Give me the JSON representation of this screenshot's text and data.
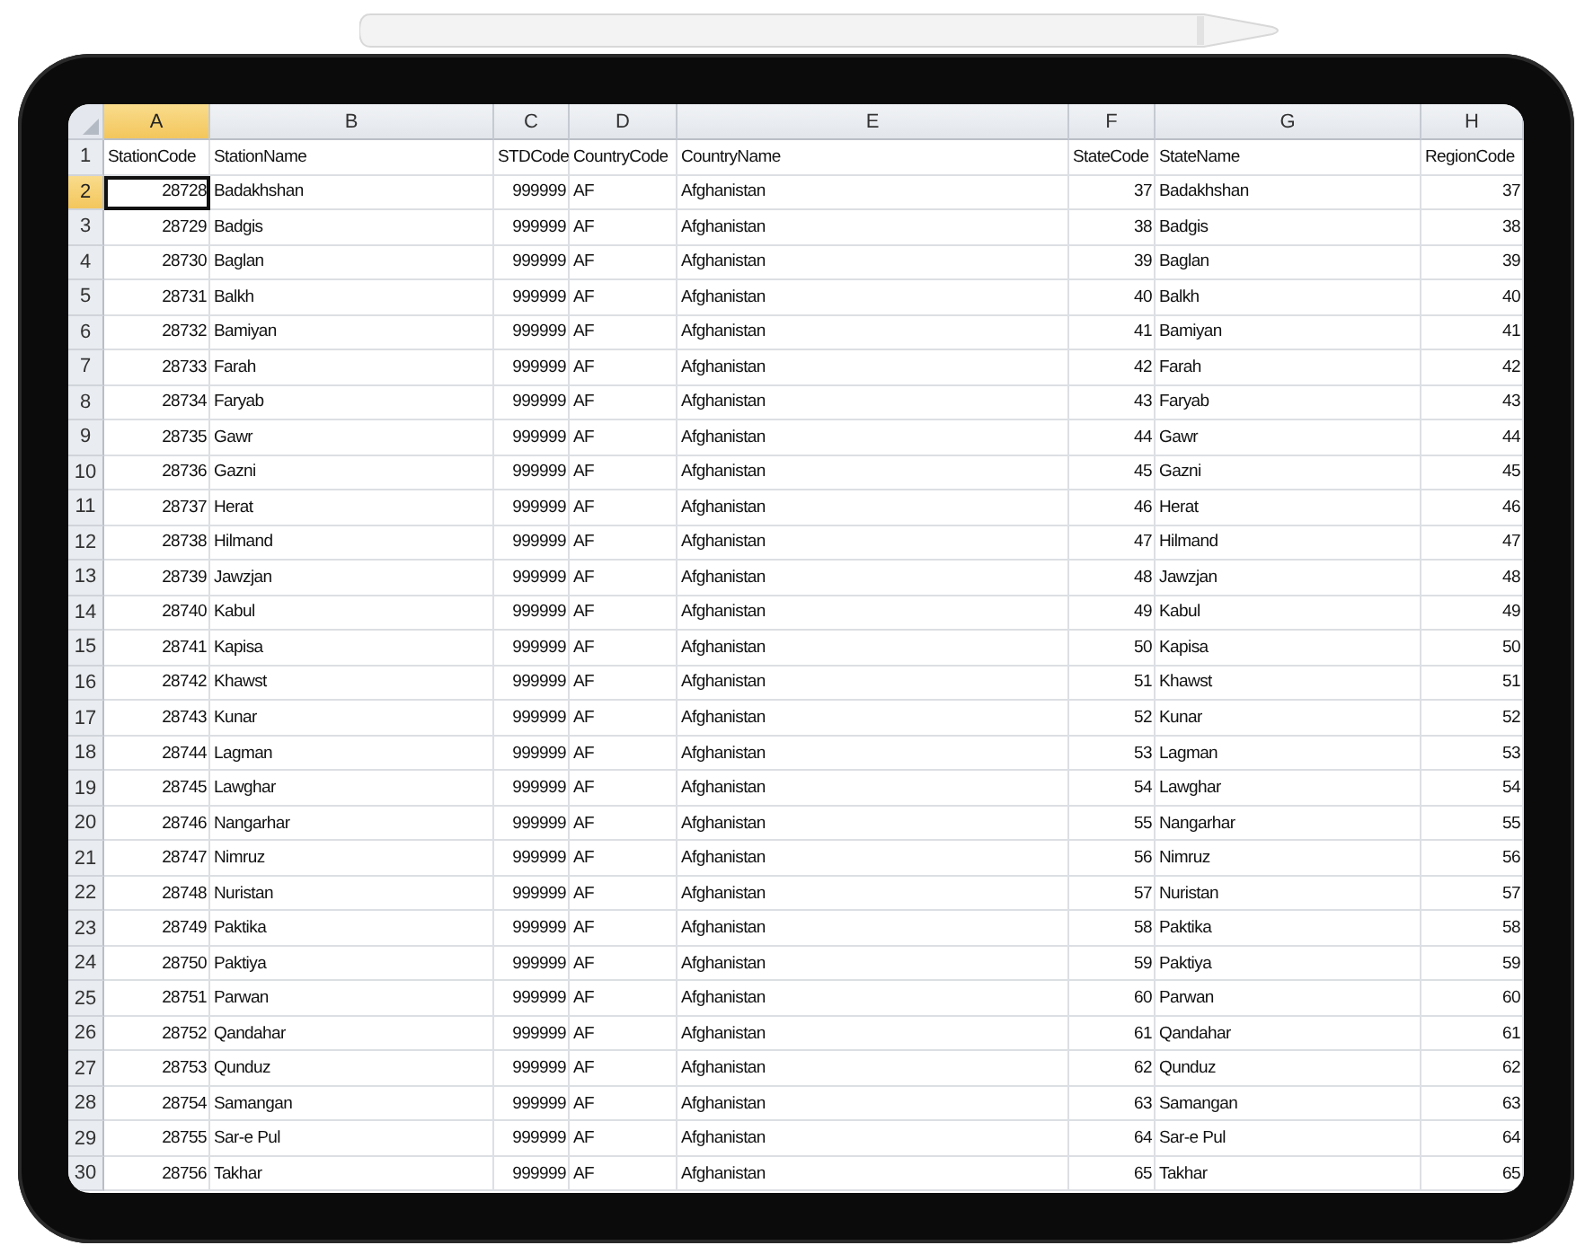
{
  "columns": [
    {
      "letter": "A",
      "selected": true,
      "kind": "number"
    },
    {
      "letter": "B",
      "selected": false,
      "kind": "text"
    },
    {
      "letter": "C",
      "selected": false,
      "kind": "number"
    },
    {
      "letter": "D",
      "selected": false,
      "kind": "text"
    },
    {
      "letter": "E",
      "selected": false,
      "kind": "text"
    },
    {
      "letter": "F",
      "selected": false,
      "kind": "number"
    },
    {
      "letter": "G",
      "selected": false,
      "kind": "text"
    },
    {
      "letter": "H",
      "selected": false,
      "kind": "number"
    }
  ],
  "rows": [
    {
      "number": "1",
      "selected": false,
      "kind": "header",
      "cells": [
        "StationCode",
        "StationName",
        "STDCode",
        "CountryCode",
        "CountryName",
        "StateCode",
        "StateName",
        "RegionCode"
      ]
    },
    {
      "number": "2",
      "selected": true,
      "kind": "data",
      "cells": [
        "28728",
        "Badakhshan",
        "999999",
        "AF",
        "Afghanistan",
        "37",
        "Badakhshan",
        "37"
      ]
    },
    {
      "number": "3",
      "selected": false,
      "kind": "data",
      "cells": [
        "28729",
        "Badgis",
        "999999",
        "AF",
        "Afghanistan",
        "38",
        "Badgis",
        "38"
      ]
    },
    {
      "number": "4",
      "selected": false,
      "kind": "data",
      "cells": [
        "28730",
        "Baglan",
        "999999",
        "AF",
        "Afghanistan",
        "39",
        "Baglan",
        "39"
      ]
    },
    {
      "number": "5",
      "selected": false,
      "kind": "data",
      "cells": [
        "28731",
        "Balkh",
        "999999",
        "AF",
        "Afghanistan",
        "40",
        "Balkh",
        "40"
      ]
    },
    {
      "number": "6",
      "selected": false,
      "kind": "data",
      "cells": [
        "28732",
        "Bamiyan",
        "999999",
        "AF",
        "Afghanistan",
        "41",
        "Bamiyan",
        "41"
      ]
    },
    {
      "number": "7",
      "selected": false,
      "kind": "data",
      "cells": [
        "28733",
        "Farah",
        "999999",
        "AF",
        "Afghanistan",
        "42",
        "Farah",
        "42"
      ]
    },
    {
      "number": "8",
      "selected": false,
      "kind": "data",
      "cells": [
        "28734",
        "Faryab",
        "999999",
        "AF",
        "Afghanistan",
        "43",
        "Faryab",
        "43"
      ]
    },
    {
      "number": "9",
      "selected": false,
      "kind": "data",
      "cells": [
        "28735",
        "Gawr",
        "999999",
        "AF",
        "Afghanistan",
        "44",
        "Gawr",
        "44"
      ]
    },
    {
      "number": "10",
      "selected": false,
      "kind": "data",
      "cells": [
        "28736",
        "Gazni",
        "999999",
        "AF",
        "Afghanistan",
        "45",
        "Gazni",
        "45"
      ]
    },
    {
      "number": "11",
      "selected": false,
      "kind": "data",
      "cells": [
        "28737",
        "Herat",
        "999999",
        "AF",
        "Afghanistan",
        "46",
        "Herat",
        "46"
      ]
    },
    {
      "number": "12",
      "selected": false,
      "kind": "data",
      "cells": [
        "28738",
        "Hilmand",
        "999999",
        "AF",
        "Afghanistan",
        "47",
        "Hilmand",
        "47"
      ]
    },
    {
      "number": "13",
      "selected": false,
      "kind": "data",
      "cells": [
        "28739",
        "Jawzjan",
        "999999",
        "AF",
        "Afghanistan",
        "48",
        "Jawzjan",
        "48"
      ]
    },
    {
      "number": "14",
      "selected": false,
      "kind": "data",
      "cells": [
        "28740",
        "Kabul",
        "999999",
        "AF",
        "Afghanistan",
        "49",
        "Kabul",
        "49"
      ]
    },
    {
      "number": "15",
      "selected": false,
      "kind": "data",
      "cells": [
        "28741",
        "Kapisa",
        "999999",
        "AF",
        "Afghanistan",
        "50",
        "Kapisa",
        "50"
      ]
    },
    {
      "number": "16",
      "selected": false,
      "kind": "data",
      "cells": [
        "28742",
        "Khawst",
        "999999",
        "AF",
        "Afghanistan",
        "51",
        "Khawst",
        "51"
      ]
    },
    {
      "number": "17",
      "selected": false,
      "kind": "data",
      "cells": [
        "28743",
        "Kunar",
        "999999",
        "AF",
        "Afghanistan",
        "52",
        "Kunar",
        "52"
      ]
    },
    {
      "number": "18",
      "selected": false,
      "kind": "data",
      "cells": [
        "28744",
        "Lagman",
        "999999",
        "AF",
        "Afghanistan",
        "53",
        "Lagman",
        "53"
      ]
    },
    {
      "number": "19",
      "selected": false,
      "kind": "data",
      "cells": [
        "28745",
        "Lawghar",
        "999999",
        "AF",
        "Afghanistan",
        "54",
        "Lawghar",
        "54"
      ]
    },
    {
      "number": "20",
      "selected": false,
      "kind": "data",
      "cells": [
        "28746",
        "Nangarhar",
        "999999",
        "AF",
        "Afghanistan",
        "55",
        "Nangarhar",
        "55"
      ]
    },
    {
      "number": "21",
      "selected": false,
      "kind": "data",
      "cells": [
        "28747",
        "Nimruz",
        "999999",
        "AF",
        "Afghanistan",
        "56",
        "Nimruz",
        "56"
      ]
    },
    {
      "number": "22",
      "selected": false,
      "kind": "data",
      "cells": [
        "28748",
        "Nuristan",
        "999999",
        "AF",
        "Afghanistan",
        "57",
        "Nuristan",
        "57"
      ]
    },
    {
      "number": "23",
      "selected": false,
      "kind": "data",
      "cells": [
        "28749",
        "Paktika",
        "999999",
        "AF",
        "Afghanistan",
        "58",
        "Paktika",
        "58"
      ]
    },
    {
      "number": "24",
      "selected": false,
      "kind": "data",
      "cells": [
        "28750",
        "Paktiya",
        "999999",
        "AF",
        "Afghanistan",
        "59",
        "Paktiya",
        "59"
      ]
    },
    {
      "number": "25",
      "selected": false,
      "kind": "data",
      "cells": [
        "28751",
        "Parwan",
        "999999",
        "AF",
        "Afghanistan",
        "60",
        "Parwan",
        "60"
      ]
    },
    {
      "number": "26",
      "selected": false,
      "kind": "data",
      "cells": [
        "28752",
        "Qandahar",
        "999999",
        "AF",
        "Afghanistan",
        "61",
        "Qandahar",
        "61"
      ]
    },
    {
      "number": "27",
      "selected": false,
      "kind": "data",
      "cells": [
        "28753",
        "Qunduz",
        "999999",
        "AF",
        "Afghanistan",
        "62",
        "Qunduz",
        "62"
      ]
    },
    {
      "number": "28",
      "selected": false,
      "kind": "data",
      "cells": [
        "28754",
        "Samangan",
        "999999",
        "AF",
        "Afghanistan",
        "63",
        "Samangan",
        "63"
      ]
    },
    {
      "number": "29",
      "selected": false,
      "kind": "data",
      "cells": [
        "28755",
        "Sar-e Pul",
        "999999",
        "AF",
        "Afghanistan",
        "64",
        "Sar-e Pul",
        "64"
      ]
    },
    {
      "number": "30",
      "selected": false,
      "kind": "data",
      "cells": [
        "28756",
        "Takhar",
        "999999",
        "AF",
        "Afghanistan",
        "65",
        "Takhar",
        "65"
      ]
    }
  ]
}
